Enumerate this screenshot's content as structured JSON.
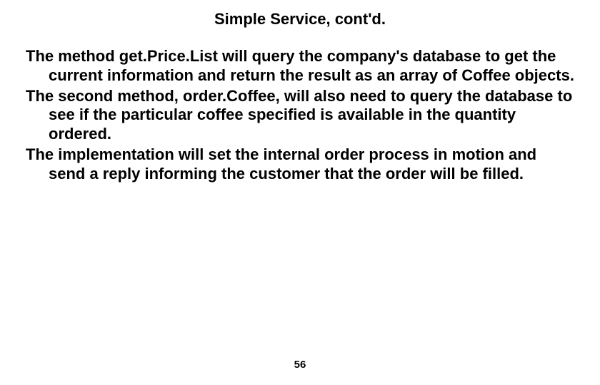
{
  "slide": {
    "title": "Simple Service, cont'd.",
    "paragraphs": [
      "The method get.Price.List will query the company's database to get the current information and return the result as an array of Coffee objects.",
      "The second method, order.Coffee, will also need to query the database to see if the particular coffee specified is available in the quantity ordered.",
      "The implementation will set the internal order process in motion and send a reply informing the customer that the order will be filled."
    ],
    "page_number": "56"
  }
}
